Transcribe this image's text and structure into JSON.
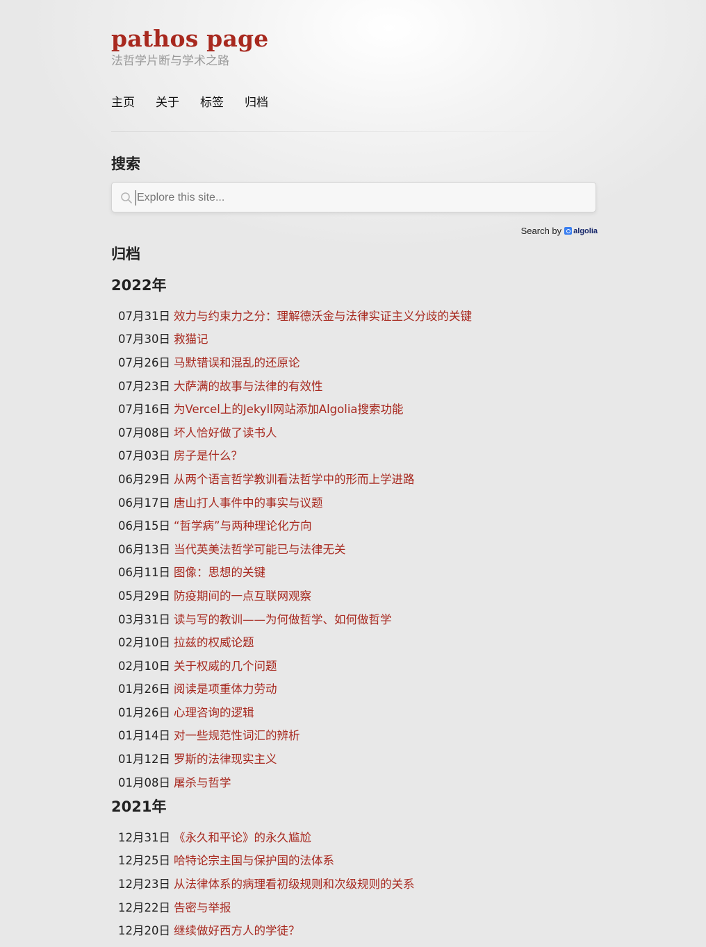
{
  "site": {
    "title": "pathos page",
    "subtitle": "法哲学片断与学术之路"
  },
  "nav": [
    "主页",
    "关于",
    "标签",
    "归档"
  ],
  "search": {
    "heading": "搜索",
    "placeholder": "Explore this site...",
    "powered_by": "Search by",
    "provider": "algolia"
  },
  "archive": {
    "heading": "归档",
    "years": [
      {
        "year": "2022年",
        "posts": [
          {
            "date": "07月31日",
            "title": "效力与约束力之分：理解德沃金与法律实证主义分歧的关键"
          },
          {
            "date": "07月30日",
            "title": "救猫记"
          },
          {
            "date": "07月26日",
            "title": "马默错误和混乱的还原论"
          },
          {
            "date": "07月23日",
            "title": "大萨满的故事与法律的有效性"
          },
          {
            "date": "07月16日",
            "title": "为Vercel上的Jekyll网站添加Algolia搜索功能"
          },
          {
            "date": "07月08日",
            "title": "坏人恰好做了读书人"
          },
          {
            "date": "07月03日",
            "title": "房子是什么？"
          },
          {
            "date": "06月29日",
            "title": "从两个语言哲学教训看法哲学中的形而上学进路"
          },
          {
            "date": "06月17日",
            "title": "唐山打人事件中的事实与议题"
          },
          {
            "date": "06月15日",
            "title": "“哲学病”与两种理论化方向"
          },
          {
            "date": "06月13日",
            "title": "当代英美法哲学可能已与法律无关"
          },
          {
            "date": "06月11日",
            "title": "图像：思想的关键"
          },
          {
            "date": "05月29日",
            "title": "防疫期间的一点互联网观察"
          },
          {
            "date": "03月31日",
            "title": "读与写的教训——为何做哲学、如何做哲学"
          },
          {
            "date": "02月10日",
            "title": "拉兹的权威论题"
          },
          {
            "date": "02月10日",
            "title": "关于权威的几个问题"
          },
          {
            "date": "01月26日",
            "title": "阅读是项重体力劳动"
          },
          {
            "date": "01月26日",
            "title": "心理咨询的逻辑"
          },
          {
            "date": "01月14日",
            "title": "对一些规范性词汇的辨析"
          },
          {
            "date": "01月12日",
            "title": "罗斯的法律现实主义"
          },
          {
            "date": "01月08日",
            "title": "屠杀与哲学"
          }
        ]
      },
      {
        "year": "2021年",
        "posts": [
          {
            "date": "12月31日",
            "title": "《永久和平论》的永久尴尬"
          },
          {
            "date": "12月25日",
            "title": "哈特论宗主国与保护国的法体系"
          },
          {
            "date": "12月23日",
            "title": "从法律体系的病理看初级规则和次级规则的关系"
          },
          {
            "date": "12月22日",
            "title": "告密与举报"
          },
          {
            "date": "12月20日",
            "title": "继续做好西方人的学徒？"
          }
        ]
      }
    ]
  }
}
